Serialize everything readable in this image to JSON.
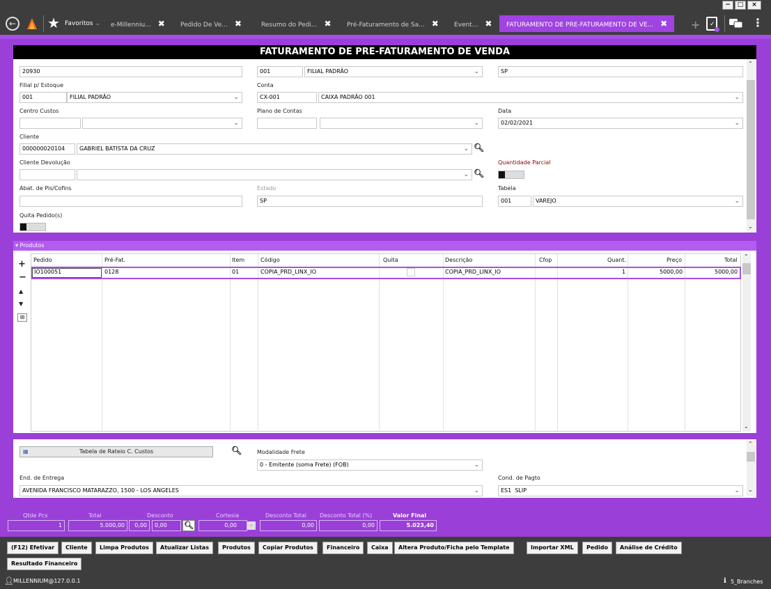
{
  "window": {
    "minimize": "−",
    "maximize": "□",
    "close": "×"
  },
  "tabs": {
    "favorites": "Favoritos",
    "items": [
      {
        "label": "e-Millenniu..."
      },
      {
        "label": "Pedido De Ve..."
      },
      {
        "label": "Resumo do Pedi..."
      },
      {
        "label": "Pré-Faturamento de Sa..."
      },
      {
        "label": "Event..."
      },
      {
        "label": "FATURAMENTO DE PRE-FATURAMENTO DE VE..."
      }
    ]
  },
  "title": "FATURAMENTO DE PRE-FATURAMENTO DE VENDA",
  "form": {
    "romaneio": "20930",
    "filial_code": "001",
    "filial_name": "FILIAL PADRÃO",
    "estado_filial": "SP",
    "filial_estoque_label": "Filial p/ Estoque",
    "filial_estoque_code": "001",
    "filial_estoque_name": "FILIAL PADRÃO",
    "conta_label": "Conta",
    "conta_code": "CX-001",
    "conta_name": "CAIXA PADRÃO 001",
    "centro_label": "Centro Custos",
    "plano_label": "Plano de Contas",
    "data_label": "Data",
    "data": "02/02/2021",
    "cliente_label": "Cliente",
    "cliente_code": "000000020104",
    "cliente_name": "GABRIEL BATISTA DA CRUZ",
    "cliente_dev_label": "Cliente Devolução",
    "qtd_parcial_label": "Quantidade Parcial",
    "abat_label": "Abat. de Pis/Cofins",
    "estado_label": "Estado",
    "estado": "SP",
    "tabela_label": "Tabela",
    "tabela_code": "001",
    "tabela_name": "VAREJO",
    "quita_label": "Quita Pedido(s)"
  },
  "products": {
    "header": "▾ Produtos",
    "columns": [
      "Pedido",
      "Pré-Fat.",
      "Item",
      "Código",
      "Quita",
      "Descrição",
      "Cfop",
      "Quant.",
      "Preço",
      "Total"
    ],
    "rows": [
      {
        "pedido": "IO100051",
        "prefat": "0128",
        "item": "01",
        "codigo": "COPIA_PRD_LINX_IO",
        "descricao": "COPIA_PRD_LINX_IO",
        "cfop": "",
        "quant": "1",
        "preco": "5000,00",
        "total": "5000,00"
      }
    ]
  },
  "bottom": {
    "rateio": "Tabela de Rateio C. Custos",
    "modalidade_label": "Modalidade Frete",
    "modalidade": "0 - Emitente (soma Frete) (FOB)",
    "entrega_label": "End. de Entrega",
    "entrega": "AVENIDA FRANCISCO MATARAZZO, 1500 - LOS ANGELES",
    "pagto_label": "Cond. de Pagto",
    "pagto_code": "ES1",
    "pagto_name": "SLIP"
  },
  "totals": {
    "qtde_label": "Qtde Pcs",
    "qtde": "1",
    "total_label": "Total",
    "total": "5.000,00",
    "desconto_label": "Desconto",
    "desc1": "0,00",
    "desc2": "0,00",
    "cortesia_label": "Cortesia",
    "cortesia": "0,00",
    "desc_total_label": "Desconto Total",
    "desc_total": "0,00",
    "desc_pct_label": "Desconto Total (%)",
    "desc_pct": "0,00",
    "valor_final_label": "Valor Final",
    "valor_final": "5.023,40"
  },
  "buttons": [
    "(F12) Efetivar",
    "Cliente",
    "Limpa Produtos",
    "Atualizar Listas",
    "Produtos",
    "Copiar Produtos",
    "Financeiro",
    "Caixa",
    "Altera Produto/Ficha pelo Template",
    "Importar XML",
    "Pedido",
    "Análise de Crédito",
    "Resultado Financeiro"
  ],
  "status": {
    "user": "MILLENNIUM@127.0.0.1",
    "branch": "5_Branches"
  },
  "colors": {
    "accent": "#9a3fd8",
    "tab_active": "#a043e0",
    "dark": "#3d3d3d"
  }
}
